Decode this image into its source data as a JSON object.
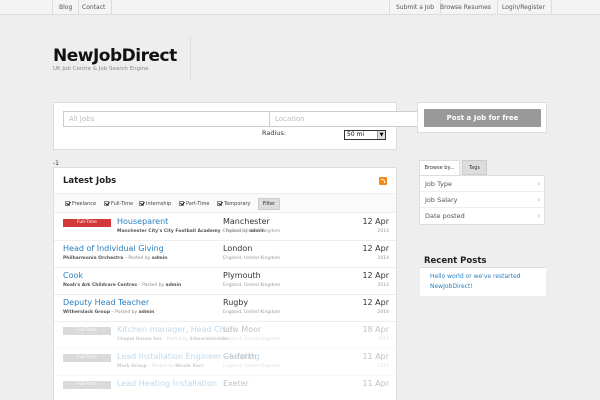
{
  "topnav": {
    "blog": "Blog",
    "contact": "Contact",
    "submit": "Submit a Job",
    "browse": "Browse Resumes",
    "login": "Login/Register"
  },
  "header": {
    "logo": "NewJobDirect",
    "tagline": "UK Job Centre & Job Search Engine"
  },
  "search": {
    "keywords_placeholder": "All Jobs",
    "location_placeholder": "Location",
    "radius_label": "Radius:",
    "radius_value": "50 mi",
    "stray_text": "-1"
  },
  "jobs": {
    "title": "Latest Jobs",
    "filters": [
      "Freelance",
      "Full-Time",
      "Internship",
      "Part-Time",
      "Temporary"
    ],
    "filter_button": "Filter",
    "items": [
      {
        "badge": "Full-Time",
        "title": "Houseparent",
        "company": "Manchester City's City Football Academy",
        "posted_by": "admin",
        "location": "Manchester",
        "country": "England, United Kingdom",
        "date": "12 Apr",
        "year": "2014"
      },
      {
        "badge": "",
        "title": "Head of Individual Giving",
        "company": "Philharmonia Orchestra",
        "posted_by": "admin",
        "location": "London",
        "country": "England, United Kingdom",
        "date": "12 Apr",
        "year": "2014"
      },
      {
        "badge": "",
        "title": "Cook",
        "company": "Noah's Ark Childcare Centres",
        "posted_by": "admin",
        "location": "Plymouth",
        "country": "England, United Kingdom",
        "date": "12 Apr",
        "year": "2014"
      },
      {
        "badge": "",
        "title": "Deputy Head Teacher",
        "company": "Witherslack Group",
        "posted_by": "admin",
        "location": "Rugby",
        "country": "England, United Kingdom",
        "date": "12 Apr",
        "year": "2014"
      },
      {
        "badge": "Full-Time",
        "title": "Kitchen manager, Head Chef",
        "company": "Chapel House Inn",
        "posted_by": "Edwardsinsider",
        "location": "Low Moor",
        "country": "England, United Kingdom",
        "date": "18 Apr",
        "year": "2014"
      },
      {
        "badge": "Full-Time",
        "title": "Lead Installation Engineer - heating",
        "company": "Mark Group",
        "posted_by": "Nicole Kerr",
        "location": "Garforth",
        "country": "England, United Kingdom",
        "date": "11 Apr",
        "year": "2014"
      },
      {
        "badge": "Full-Time",
        "title": "Lead Heating Installation",
        "company": "",
        "posted_by": "",
        "location": "Exeter",
        "country": "",
        "date": "11 Apr",
        "year": ""
      }
    ]
  },
  "sidebar": {
    "post_button": "Post a Job for free",
    "tabs": [
      "Browse by...",
      "Tags"
    ],
    "browse_items": [
      "Job Type",
      "Job Salary",
      "Date posted"
    ],
    "recent_title": "Recent Posts",
    "recent_posts": [
      "Hello world or we've restarted NewJobDirect!"
    ]
  }
}
